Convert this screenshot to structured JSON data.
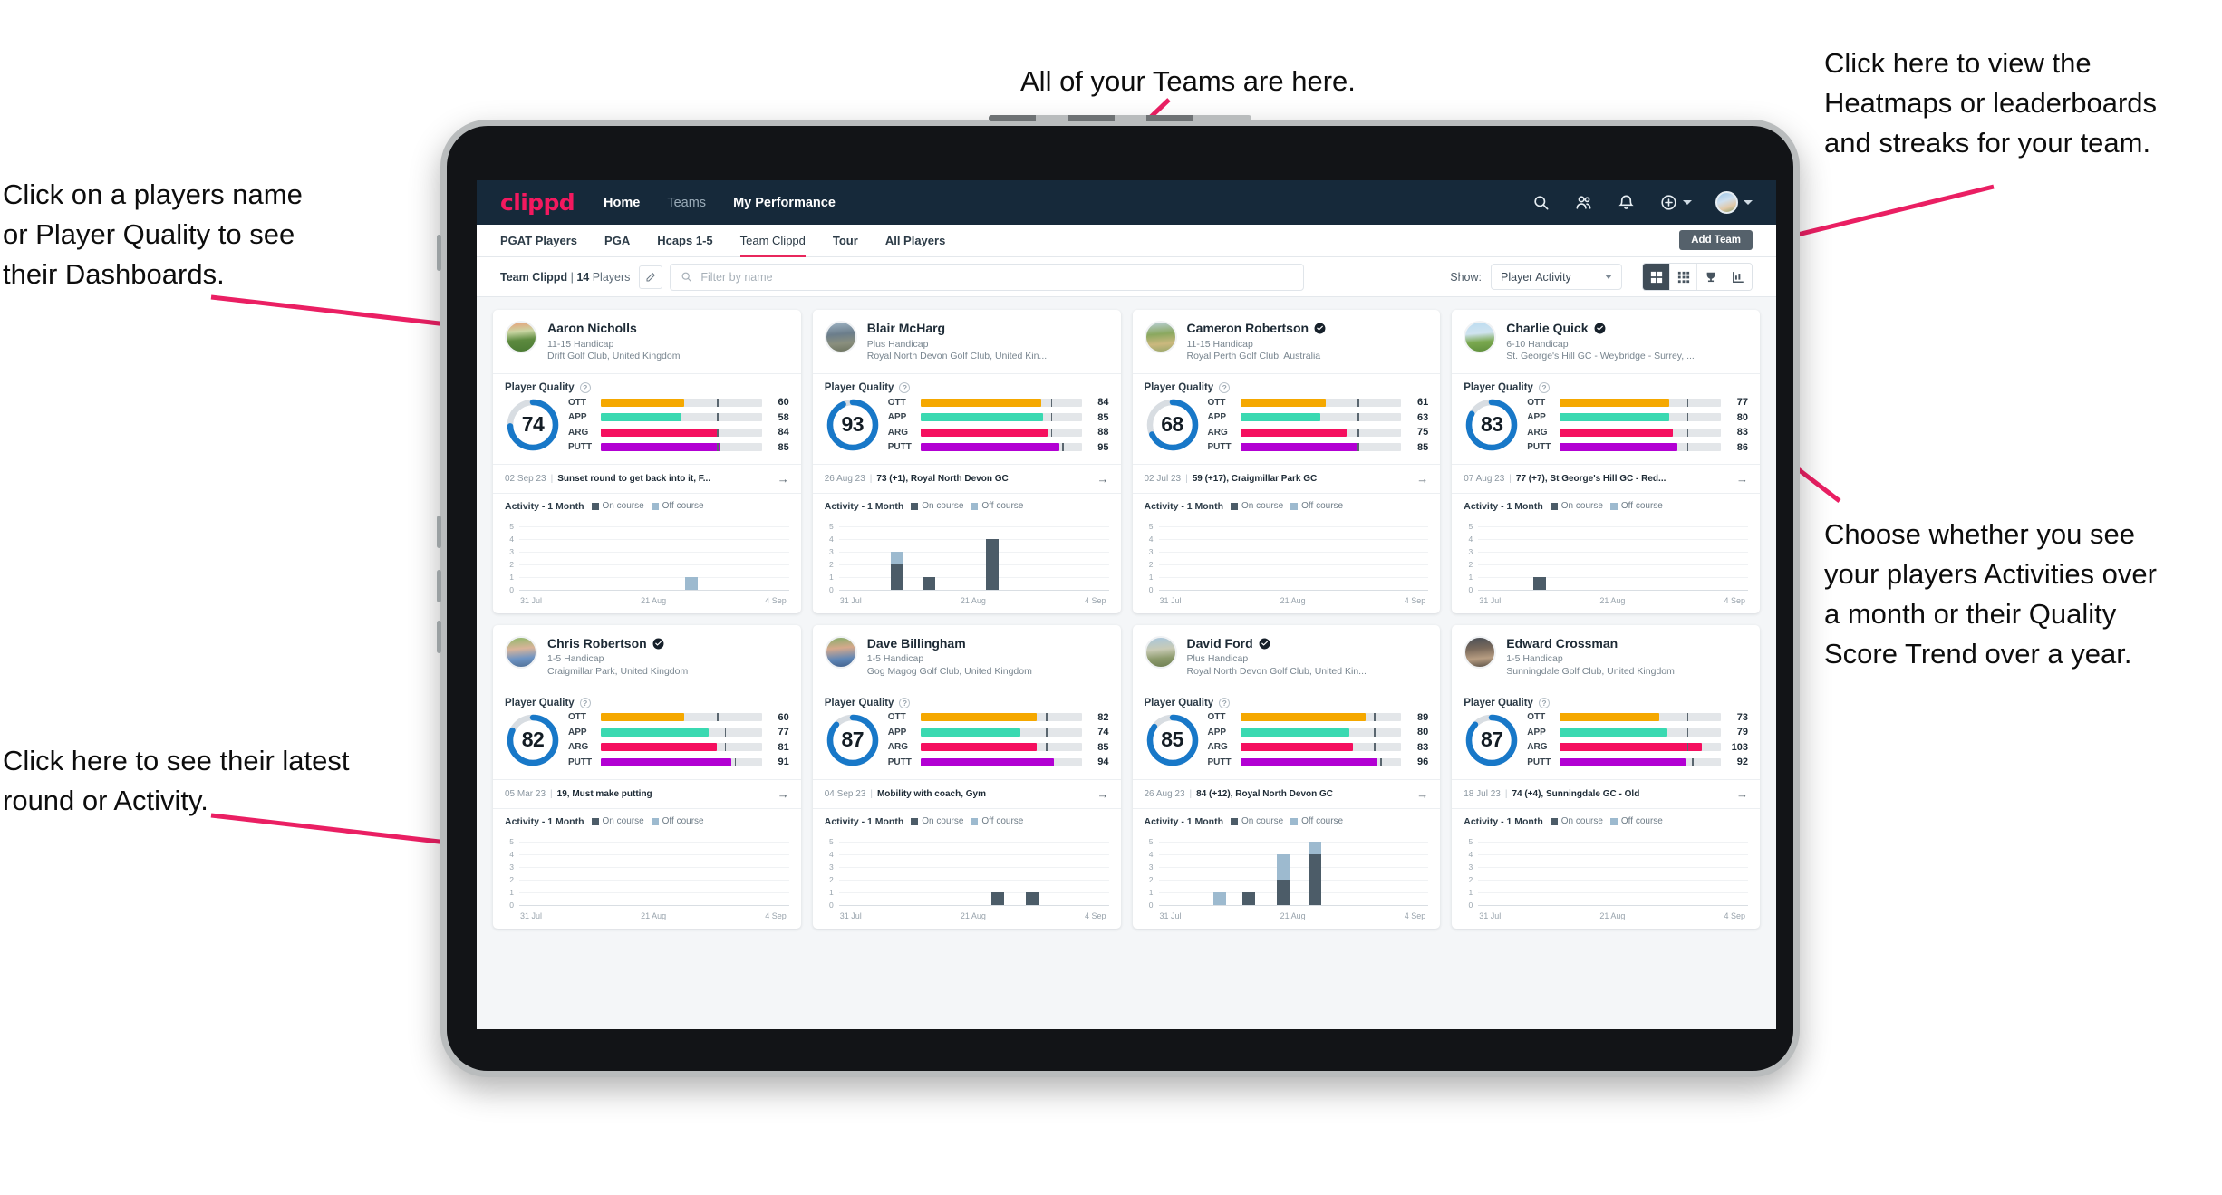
{
  "annotations": [
    {
      "id": "teams",
      "text": "All of your Teams are here."
    },
    {
      "id": "heatmaps",
      "text": "Click here to view the\nHeatmaps or leaderboards\nand streaks for your team."
    },
    {
      "id": "dashboards",
      "text": "Click on a players name\nor Player Quality to see\ntheir Dashboards."
    },
    {
      "id": "activity-toggle",
      "text": "Choose whether you see\nyour players Activities over\na month or their Quality\nScore Trend over a year."
    },
    {
      "id": "latest-round",
      "text": "Click here to see their latest\nround or Activity."
    }
  ],
  "topnav": {
    "logo": "clippd",
    "links": [
      {
        "label": "Home",
        "active": true
      },
      {
        "label": "Teams",
        "active": false
      },
      {
        "label": "My Performance",
        "active": true
      }
    ],
    "icons": [
      "search-icon",
      "people-icon",
      "bell-icon",
      "plus-circle-icon"
    ],
    "avatar": "user-avatar"
  },
  "subnav": {
    "tabs": [
      {
        "label": "PGAT Players",
        "state": "normal"
      },
      {
        "label": "PGA",
        "state": "normal"
      },
      {
        "label": "Hcaps 1-5",
        "state": "normal"
      },
      {
        "label": "Team Clippd",
        "state": "active"
      },
      {
        "label": "Tour",
        "state": "normal"
      },
      {
        "label": "All Players",
        "state": "normal"
      }
    ],
    "add_team_label": "Add Team"
  },
  "toolbar": {
    "team_name": "Team Clippd",
    "team_separator": "|",
    "team_count": "14",
    "team_count_suffix": "Players",
    "edit_icon": "pencil-icon",
    "search_placeholder": "Filter by name",
    "show_label": "Show:",
    "show_value": "Player Activity",
    "show_options": [
      "Player Activity",
      "Quality Score Trend"
    ],
    "views": [
      {
        "name": "grid-view",
        "icon": "grid-large-icon",
        "active": true
      },
      {
        "name": "dense-grid-view",
        "icon": "grid-small-icon",
        "active": false
      },
      {
        "name": "leaderboard-view",
        "icon": "trophy-icon",
        "active": false
      },
      {
        "name": "heatmap-view",
        "icon": "chart-bars-icon",
        "active": false
      }
    ]
  },
  "card_labels": {
    "player_quality": "Player Quality",
    "activity": "Activity - 1 Month",
    "legend_on": "On course",
    "legend_off": "Off course",
    "arrow": "→",
    "separator": "|"
  },
  "metric_colors": {
    "OTT": "#f5a800",
    "APP": "#3ad9b1",
    "ARG": "#f50f5f",
    "PUTT": "#b200d3",
    "ring": "#1878c8",
    "ring_track": "#d8dde2"
  },
  "chart_axis": {
    "yticks": [
      "5",
      "4",
      "3",
      "2",
      "1",
      "0"
    ],
    "ymax": 5,
    "xticks": [
      "31 Jul",
      "21 Aug",
      "4 Sep"
    ]
  },
  "players": [
    {
      "name": "Aaron Nicholls",
      "verified": false,
      "handicap": "11-15 Handicap",
      "club": "Drift Golf Club, United Kingdom",
      "quality": 74,
      "metrics": [
        {
          "label": "OTT",
          "value": 60,
          "fill": 52,
          "tick": 72
        },
        {
          "label": "APP",
          "value": 58,
          "fill": 50,
          "tick": 72
        },
        {
          "label": "ARG",
          "value": 84,
          "fill": 73,
          "tick": 72
        },
        {
          "label": "PUTT",
          "value": 85,
          "fill": 74,
          "tick": 72
        }
      ],
      "latest_date": "02 Sep 23",
      "latest_text": "Sunset round to get back into it, F...",
      "activity": [
        {
          "x": 0.62,
          "on": 0,
          "off": 1
        }
      ]
    },
    {
      "name": "Blair McHarg",
      "verified": false,
      "handicap": "Plus Handicap",
      "club": "Royal North Devon Golf Club, United Kin...",
      "quality": 93,
      "metrics": [
        {
          "label": "OTT",
          "value": 84,
          "fill": 75,
          "tick": 81
        },
        {
          "label": "APP",
          "value": 85,
          "fill": 76,
          "tick": 81
        },
        {
          "label": "ARG",
          "value": 88,
          "fill": 79,
          "tick": 81
        },
        {
          "label": "PUTT",
          "value": 95,
          "fill": 86,
          "tick": 88
        }
      ],
      "latest_date": "26 Aug 23",
      "latest_text": "73 (+1), Royal North Devon GC",
      "activity": [
        {
          "x": 0.19,
          "on": 2,
          "off": 1
        },
        {
          "x": 0.31,
          "on": 1,
          "off": 0
        },
        {
          "x": 0.55,
          "on": 4,
          "off": 0
        }
      ]
    },
    {
      "name": "Cameron Robertson",
      "verified": true,
      "handicap": "11-15 Handicap",
      "club": "Royal Perth Golf Club, Australia",
      "quality": 68,
      "metrics": [
        {
          "label": "OTT",
          "value": 61,
          "fill": 53,
          "tick": 73
        },
        {
          "label": "APP",
          "value": 63,
          "fill": 50,
          "tick": 73
        },
        {
          "label": "ARG",
          "value": 75,
          "fill": 66,
          "tick": 73
        },
        {
          "label": "PUTT",
          "value": 85,
          "fill": 74,
          "tick": 73
        }
      ],
      "latest_date": "02 Jul 23",
      "latest_text": "59 (+17), Craigmillar Park GC",
      "activity": []
    },
    {
      "name": "Charlie Quick",
      "verified": true,
      "handicap": "6-10 Handicap",
      "club": "St. George's Hill GC - Weybridge - Surrey, ...",
      "quality": 83,
      "metrics": [
        {
          "label": "OTT",
          "value": 77,
          "fill": 68,
          "tick": 79
        },
        {
          "label": "APP",
          "value": 80,
          "fill": 68,
          "tick": 79
        },
        {
          "label": "ARG",
          "value": 83,
          "fill": 70,
          "tick": 79
        },
        {
          "label": "PUTT",
          "value": 86,
          "fill": 73,
          "tick": 79
        }
      ],
      "latest_date": "07 Aug 23",
      "latest_text": "77 (+7), St George's Hill GC - Red...",
      "activity": [
        {
          "x": 0.2,
          "on": 1,
          "off": 0
        }
      ]
    },
    {
      "name": "Chris Robertson",
      "verified": true,
      "handicap": "1-5 Handicap",
      "club": "Craigmillar Park, United Kingdom",
      "quality": 82,
      "metrics": [
        {
          "label": "OTT",
          "value": 60,
          "fill": 52,
          "tick": 72
        },
        {
          "label": "APP",
          "value": 77,
          "fill": 67,
          "tick": 77
        },
        {
          "label": "ARG",
          "value": 81,
          "fill": 72,
          "tick": 77
        },
        {
          "label": "PUTT",
          "value": 91,
          "fill": 81,
          "tick": 83
        }
      ],
      "latest_date": "05 Mar 23",
      "latest_text": "19, Must make putting",
      "activity": []
    },
    {
      "name": "Dave Billingham",
      "verified": false,
      "handicap": "1-5 Handicap",
      "club": "Gog Magog Golf Club, United Kingdom",
      "quality": 87,
      "metrics": [
        {
          "label": "OTT",
          "value": 82,
          "fill": 72,
          "tick": 78
        },
        {
          "label": "APP",
          "value": 74,
          "fill": 62,
          "tick": 78
        },
        {
          "label": "ARG",
          "value": 85,
          "fill": 72,
          "tick": 78
        },
        {
          "label": "PUTT",
          "value": 94,
          "fill": 83,
          "tick": 85
        }
      ],
      "latest_date": "04 Sep 23",
      "latest_text": "Mobility with coach, Gym",
      "activity": [
        {
          "x": 0.57,
          "on": 1,
          "off": 0
        },
        {
          "x": 0.7,
          "on": 1,
          "off": 0
        }
      ]
    },
    {
      "name": "David Ford",
      "verified": true,
      "handicap": "Plus Handicap",
      "club": "Royal North Devon Golf Club, United Kin...",
      "quality": 85,
      "metrics": [
        {
          "label": "OTT",
          "value": 89,
          "fill": 78,
          "tick": 83
        },
        {
          "label": "APP",
          "value": 80,
          "fill": 68,
          "tick": 83
        },
        {
          "label": "ARG",
          "value": 83,
          "fill": 70,
          "tick": 83
        },
        {
          "label": "PUTT",
          "value": 96,
          "fill": 85,
          "tick": 87
        }
      ],
      "latest_date": "26 Aug 23",
      "latest_text": "84 (+12), Royal North Devon GC",
      "activity": [
        {
          "x": 0.2,
          "on": 0,
          "off": 1
        },
        {
          "x": 0.31,
          "on": 1,
          "off": 0
        },
        {
          "x": 0.44,
          "on": 2,
          "off": 2
        },
        {
          "x": 0.56,
          "on": 4,
          "off": 1
        }
      ]
    },
    {
      "name": "Edward Crossman",
      "verified": false,
      "handicap": "1-5 Handicap",
      "club": "Sunningdale Golf Club, United Kingdom",
      "quality": 87,
      "metrics": [
        {
          "label": "OTT",
          "value": 73,
          "fill": 62,
          "tick": 79
        },
        {
          "label": "APP",
          "value": 79,
          "fill": 67,
          "tick": 79
        },
        {
          "label": "ARG",
          "value": 103,
          "fill": 88,
          "tick": 79
        },
        {
          "label": "PUTT",
          "value": 92,
          "fill": 78,
          "tick": 82
        }
      ],
      "latest_date": "18 Jul 23",
      "latest_text": "74 (+4), Sunningdale GC - Old",
      "activity": []
    }
  ]
}
